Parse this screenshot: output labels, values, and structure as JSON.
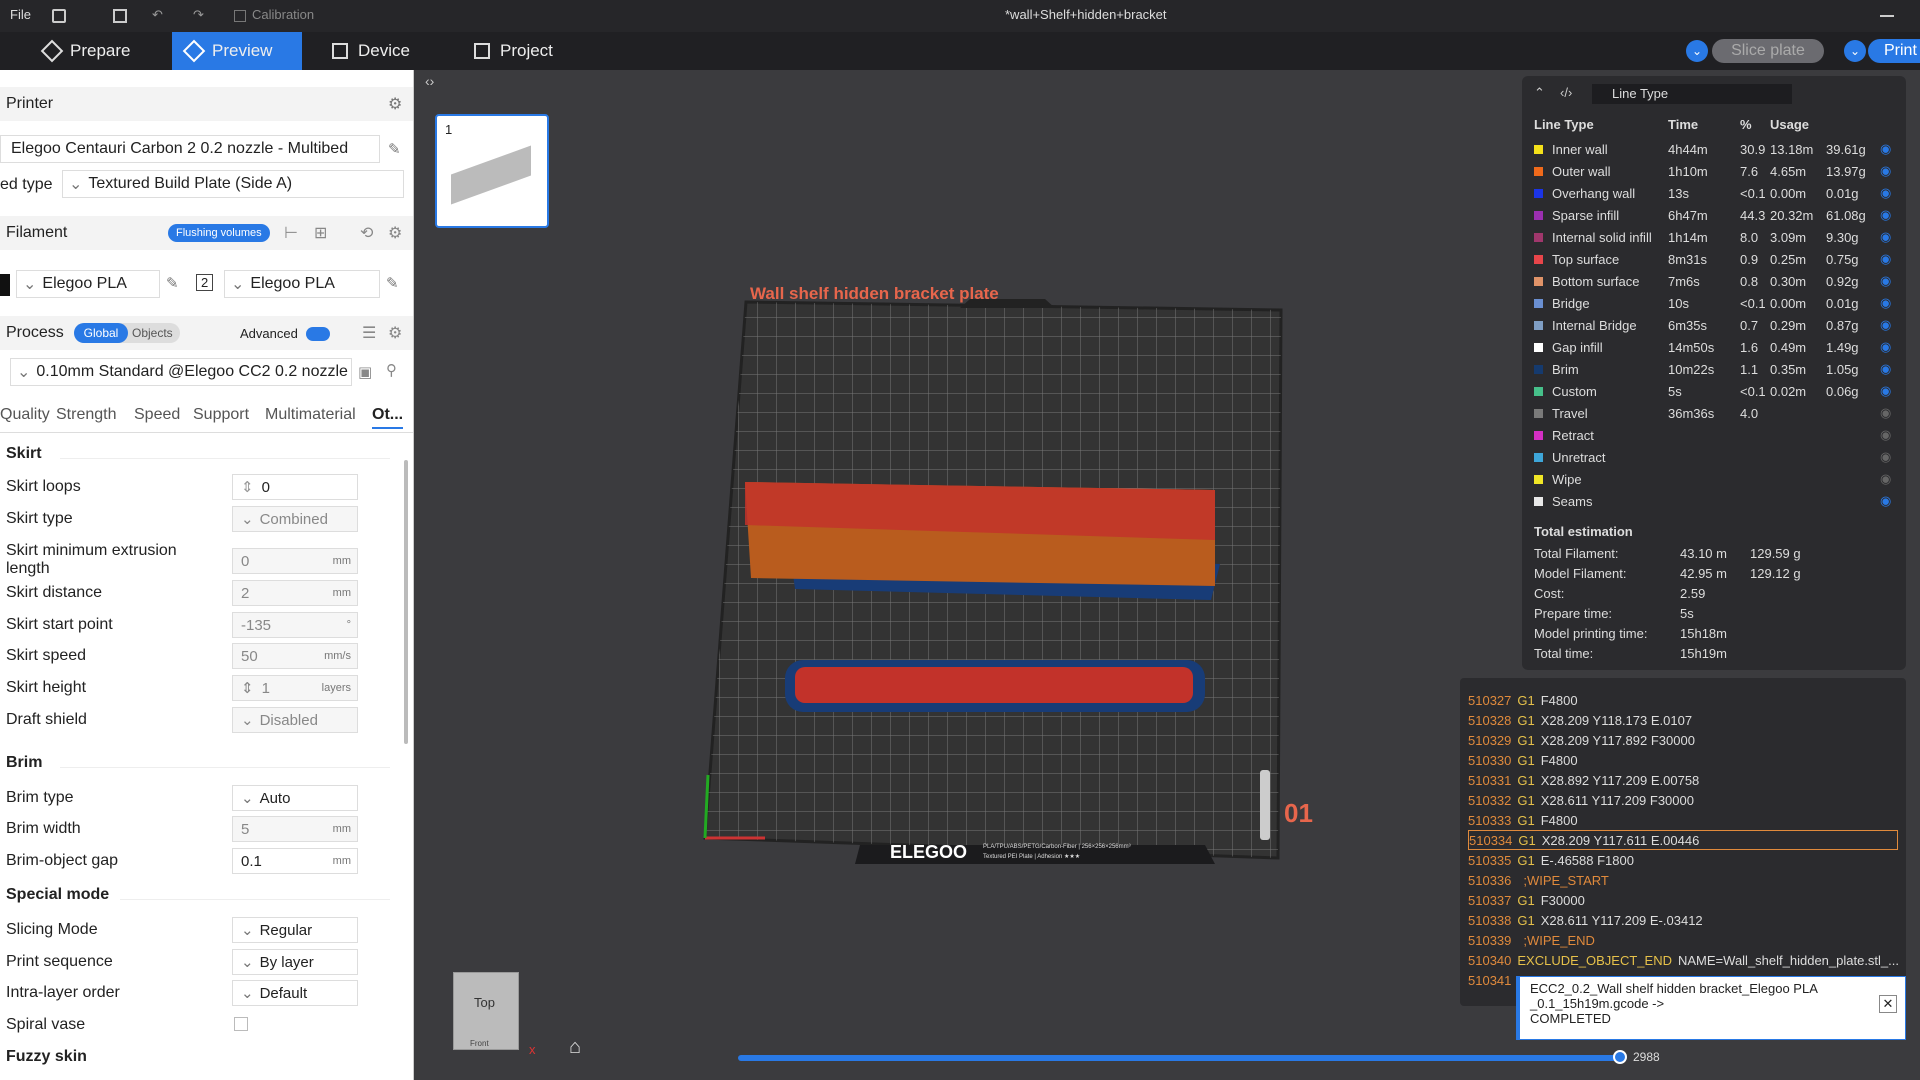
{
  "titlebar": {
    "menu_file": "File",
    "calibration": "Calibration",
    "window_title": "*wall+Shelf+hidden+bracket"
  },
  "tabs": [
    {
      "label": "Prepare"
    },
    {
      "label": "Preview"
    },
    {
      "label": "Device"
    },
    {
      "label": "Project"
    }
  ],
  "actions": {
    "slice_plate": "Slice plate",
    "print": "Print"
  },
  "left": {
    "printer_head": "Printer",
    "printer_value": "Elegoo Centauri Carbon 2 0.2 nozzle - Multibed",
    "bed_type_label": "ed type",
    "bed_type_value": "Textured Build Plate (Side A)",
    "filament_head": "Filament",
    "flushing_volumes": "Flushing volumes",
    "filament1": "Elegoo PLA",
    "filament2_index": "2",
    "filament2": "Elegoo PLA",
    "process_head": "Process",
    "global": "Global",
    "objects": "Objects",
    "advanced": "Advanced",
    "process_preset": "0.10mm Standard @Elegoo CC2 0.2 nozzle",
    "subtabs": [
      "Quality",
      "Strength",
      "Speed",
      "Support",
      "Multimaterial",
      "Ot..."
    ],
    "groups": {
      "skirt": "Skirt",
      "brim": "Brim",
      "special": "Special mode",
      "fuzzy": "Fuzzy skin"
    },
    "rows": [
      {
        "label": "Skirt loops",
        "value": "0",
        "unit": ""
      },
      {
        "label": "Skirt type",
        "value": "Combined",
        "unit": ""
      },
      {
        "label": "Skirt minimum extrusion length",
        "value": "0",
        "unit": "mm"
      },
      {
        "label": "Skirt distance",
        "value": "2",
        "unit": "mm"
      },
      {
        "label": "Skirt start point",
        "value": "-135",
        "unit": "°"
      },
      {
        "label": "Skirt speed",
        "value": "50",
        "unit": "mm/s"
      },
      {
        "label": "Skirt height",
        "value": "1",
        "unit": "layers"
      },
      {
        "label": "Draft shield",
        "value": "Disabled",
        "unit": ""
      },
      {
        "label": "Brim type",
        "value": "Auto",
        "unit": ""
      },
      {
        "label": "Brim width",
        "value": "5",
        "unit": "mm"
      },
      {
        "label": "Brim-object gap",
        "value": "0.1",
        "unit": "mm"
      },
      {
        "label": "Slicing Mode",
        "value": "Regular",
        "unit": ""
      },
      {
        "label": "Print sequence",
        "value": "By layer",
        "unit": ""
      },
      {
        "label": "Intra-layer order",
        "value": "Default",
        "unit": ""
      },
      {
        "label": "Spiral vase",
        "value": "",
        "unit": ""
      }
    ]
  },
  "viewport": {
    "plate_thumb_index": "1",
    "plate_title": "Wall shelf hidden bracket plate",
    "plate_number": "01",
    "bed_brand": "ELEGOO",
    "bed_spec": "PLA/TPU/ABS/PETG/Carbon-Fiber | 256×256×256mm³",
    "bed_spec2": "Textured PEI Plate | Adhesion ★★★",
    "view_cube": "Top",
    "view_cube_front": "Front",
    "layer_slider_value": "2988",
    "axis_x": "x"
  },
  "legend": {
    "title": "Line Type",
    "headers": [
      "Line Type",
      "Time",
      "%",
      "Usage"
    ],
    "rows": [
      {
        "name": "Inner wall",
        "color": "#f4e11a",
        "time": "4h44m",
        "pct": "30.9",
        "len": "13.18m",
        "g": "39.61g"
      },
      {
        "name": "Outer wall",
        "color": "#f06a1b",
        "time": "1h10m",
        "pct": "7.6",
        "len": "4.65m",
        "g": "13.97g"
      },
      {
        "name": "Overhang wall",
        "color": "#1b34e6",
        "time": "13s",
        "pct": "<0.1",
        "len": "0.00m",
        "g": "0.01g"
      },
      {
        "name": "Sparse infill",
        "color": "#9b2fb0",
        "time": "6h47m",
        "pct": "44.3",
        "len": "20.32m",
        "g": "61.08g"
      },
      {
        "name": "Internal solid infill",
        "color": "#a0376c",
        "time": "1h14m",
        "pct": "8.0",
        "len": "3.09m",
        "g": "9.30g"
      },
      {
        "name": "Top surface",
        "color": "#e8454a",
        "time": "8m31s",
        "pct": "0.9",
        "len": "0.25m",
        "g": "0.75g"
      },
      {
        "name": "Bottom surface",
        "color": "#e09368",
        "time": "7m6s",
        "pct": "0.8",
        "len": "0.30m",
        "g": "0.92g"
      },
      {
        "name": "Bridge",
        "color": "#6a8fd1",
        "time": "10s",
        "pct": "<0.1",
        "len": "0.00m",
        "g": "0.01g"
      },
      {
        "name": "Internal Bridge",
        "color": "#7f9ec4",
        "time": "6m35s",
        "pct": "0.7",
        "len": "0.29m",
        "g": "0.87g"
      },
      {
        "name": "Gap infill",
        "color": "#ffffff",
        "time": "14m50s",
        "pct": "1.6",
        "len": "0.49m",
        "g": "1.49g"
      },
      {
        "name": "Brim",
        "color": "#153a6e",
        "time": "10m22s",
        "pct": "1.1",
        "len": "0.35m",
        "g": "1.05g"
      },
      {
        "name": "Custom",
        "color": "#46c08a",
        "time": "5s",
        "pct": "<0.1",
        "len": "0.02m",
        "g": "0.06g"
      },
      {
        "name": "Travel",
        "color": "#7a7a7a",
        "time": "36m36s",
        "pct": "4.0",
        "len": "",
        "g": ""
      },
      {
        "name": "Retract",
        "color": "#d42fc4",
        "time": "",
        "pct": "",
        "len": "",
        "g": ""
      },
      {
        "name": "Unretract",
        "color": "#3ea6d9",
        "time": "",
        "pct": "",
        "len": "",
        "g": ""
      },
      {
        "name": "Wipe",
        "color": "#f0e626",
        "time": "",
        "pct": "",
        "len": "",
        "g": ""
      },
      {
        "name": "Seams",
        "color": "#e8e8e8",
        "time": "",
        "pct": "",
        "len": "",
        "g": ""
      }
    ],
    "total_title": "Total estimation",
    "totals": [
      {
        "k": "Total Filament:",
        "v": "43.10 m",
        "v2": "129.59 g"
      },
      {
        "k": "Model Filament:",
        "v": "42.95 m",
        "v2": "129.12 g"
      },
      {
        "k": "Cost:",
        "v": "2.59",
        "v2": ""
      },
      {
        "k": "Prepare time:",
        "v": "5s",
        "v2": ""
      },
      {
        "k": "Model printing time:",
        "v": "15h18m",
        "v2": ""
      },
      {
        "k": "Total time:",
        "v": "15h19m",
        "v2": ""
      }
    ]
  },
  "gcode": [
    {
      "n": "510327",
      "c": "G1",
      "a": "F4800"
    },
    {
      "n": "510328",
      "c": "G1",
      "a": "X28.209 Y118.173 E.0107"
    },
    {
      "n": "510329",
      "c": "G1",
      "a": "X28.209 Y117.892 F30000"
    },
    {
      "n": "510330",
      "c": "G1",
      "a": "F4800"
    },
    {
      "n": "510331",
      "c": "G1",
      "a": "X28.892 Y117.209 E.00758"
    },
    {
      "n": "510332",
      "c": "G1",
      "a": "X28.611 Y117.209 F30000"
    },
    {
      "n": "510333",
      "c": "G1",
      "a": "F4800"
    },
    {
      "n": "510334",
      "c": "G1",
      "a": "X28.209 Y117.611 E.00446"
    },
    {
      "n": "510335",
      "c": "G1",
      "a": "E-.46588 F1800"
    },
    {
      "n": "510336",
      "c": "",
      "a": ";WIPE_START"
    },
    {
      "n": "510337",
      "c": "G1",
      "a": "F30000"
    },
    {
      "n": "510338",
      "c": "G1",
      "a": "X28.611 Y117.209 E-.03412"
    },
    {
      "n": "510339",
      "c": "",
      "a": ";WIPE_END"
    },
    {
      "n": "510340",
      "c": "EXCLUDE_OBJECT_END",
      "a": "NAME=Wall_shelf_hidden_plate.stl_..."
    },
    {
      "n": "510341",
      "c": "",
      "a": ""
    }
  ],
  "toast": {
    "line1": "ECC2_0.2_Wall shelf hidden bracket_Elegoo PLA",
    "line2": "_0.1_15h19m.gcode ->",
    "line3": "COMPLETED"
  }
}
